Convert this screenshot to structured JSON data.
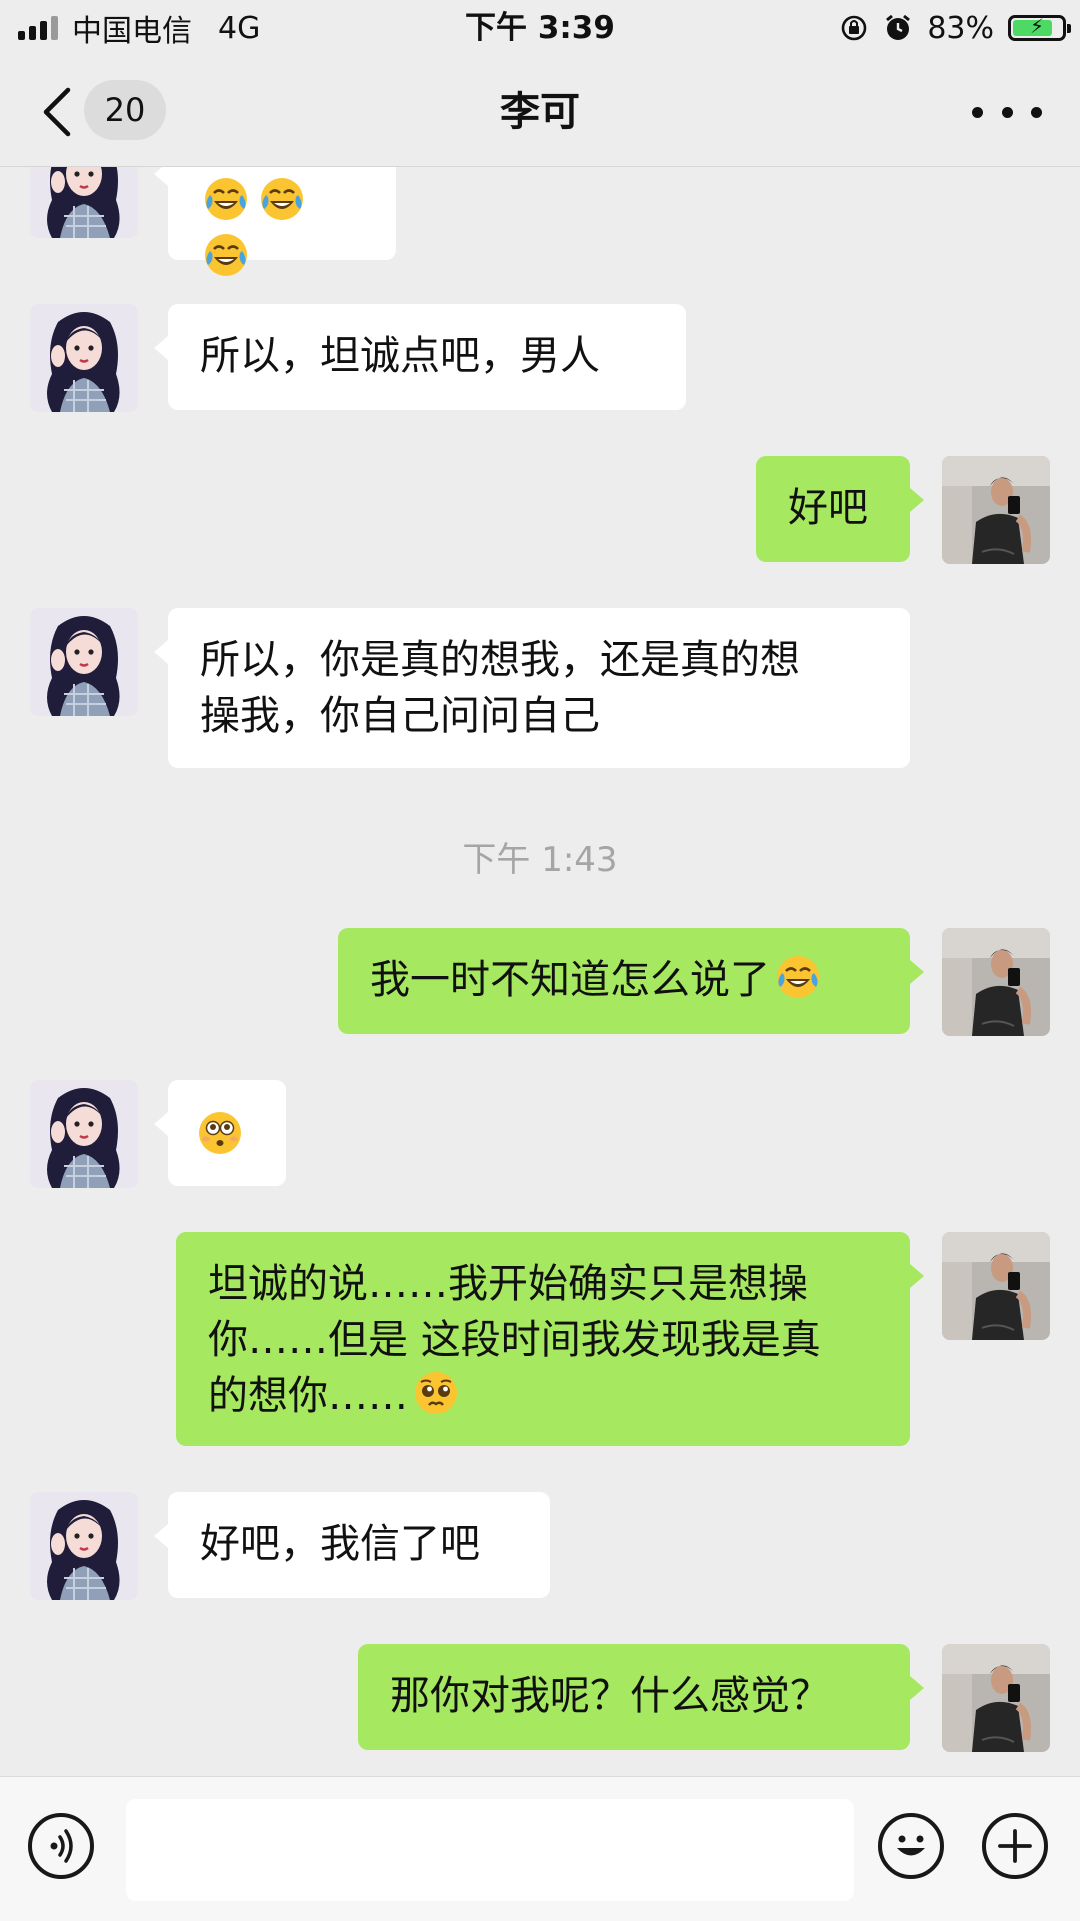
{
  "status_bar": {
    "carrier": "中国电信",
    "network": "4G",
    "time": "下午 3:39",
    "battery_percent": "83%",
    "battery_level": 0.83
  },
  "nav": {
    "unread_count": "20",
    "title": "李可",
    "back_icon": "chevron-left-icon",
    "more_icon": "more-dots-icon"
  },
  "colors": {
    "outgoing_bubble": "#a6e860",
    "incoming_bubble": "#ffffff",
    "background": "#ededed"
  },
  "messages": [
    {
      "side": "left",
      "emojis": [
        "crying-laughing",
        "crying-laughing",
        "crying-laughing"
      ]
    },
    {
      "side": "left",
      "text": "所以，坦诚点吧，男人"
    },
    {
      "side": "right",
      "text": "好吧"
    },
    {
      "side": "left",
      "line1": "所以，你是真的想我，还是真的想",
      "line2": "操我，你自己问问自己"
    },
    {
      "side": "time",
      "text": "下午 1:43"
    },
    {
      "side": "right",
      "text": "我一时不知道怎么说了",
      "emoji": "crying-laughing"
    },
    {
      "side": "left",
      "emoji": "flushed"
    },
    {
      "side": "right",
      "line1": "坦诚的说……我开始确实只是想操",
      "line2": "你……但是 这段时间我发现我是真",
      "line3": "的想你……",
      "emoji": "pleading"
    },
    {
      "side": "left",
      "text": "好吧，我信了吧"
    },
    {
      "side": "right",
      "text": "那你对我呢？什么感觉？"
    }
  ],
  "input_bar": {
    "voice_icon": "voice-icon",
    "emoji_icon": "smiley-icon",
    "plus_icon": "plus-icon",
    "input_value": ""
  }
}
